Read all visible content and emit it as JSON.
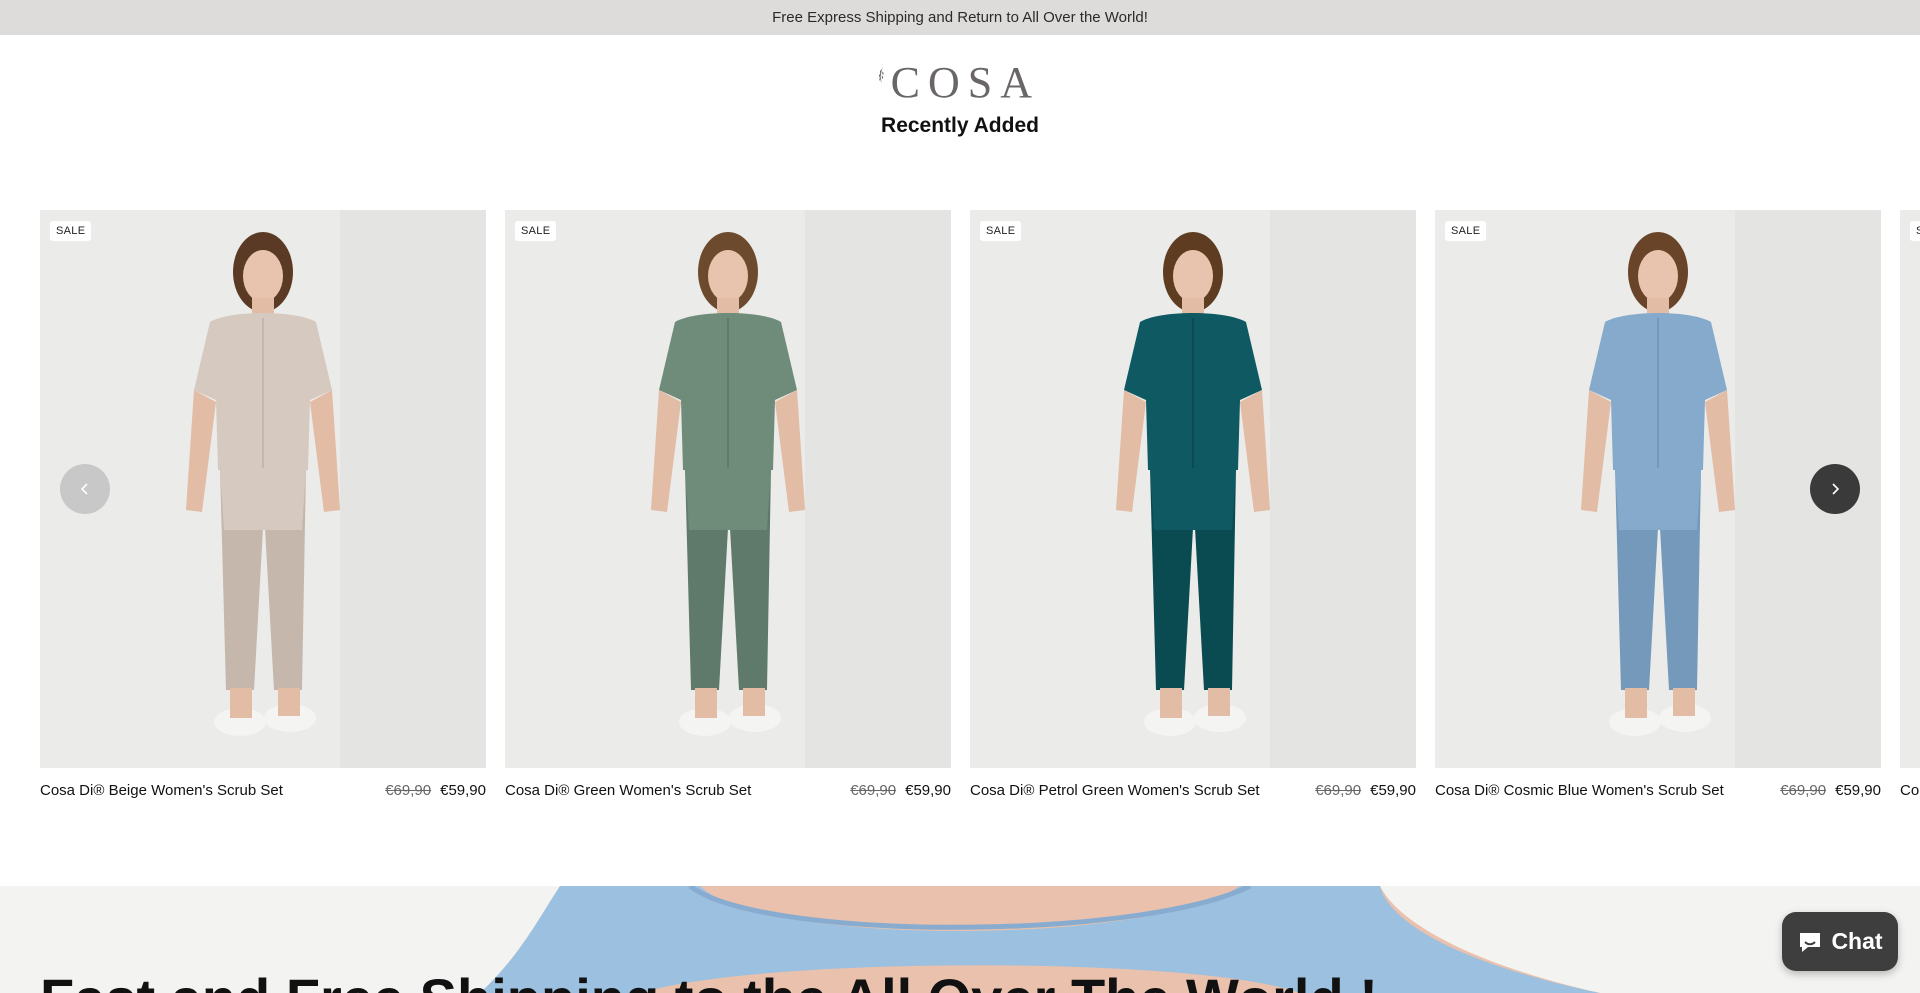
{
  "announcement": "Free Express Shipping and Return to All Over the World!",
  "brand": {
    "logo_text": "COSA"
  },
  "section_title": "Recently Added",
  "products": [
    {
      "badge": "SALE",
      "name": "Cosa Di® Beige Women's Scrub Set",
      "old_price": "€69,90",
      "price": "€59,90",
      "color": "#d6c9bf",
      "color_dark": "#c5b7ac",
      "hair": "#5a3a24"
    },
    {
      "badge": "SALE",
      "name": "Cosa Di® Green Women's Scrub Set",
      "old_price": "€69,90",
      "price": "€59,90",
      "color": "#6f8b7a",
      "color_dark": "#5f7a6a",
      "hair": "#6b4a2e"
    },
    {
      "badge": "SALE",
      "name": "Cosa Di® Petrol Green Women's Scrub Set",
      "old_price": "€69,90",
      "price": "€59,90",
      "color": "#0f5a62",
      "color_dark": "#0a4a51",
      "hair": "#5e3c22"
    },
    {
      "badge": "SALE",
      "name": "Cosa Di® Cosmic Blue Women's Scrub Set",
      "old_price": "€69,90",
      "price": "€59,90",
      "color": "#86aacb",
      "color_dark": "#7499bb",
      "hair": "#6a4428"
    },
    {
      "badge": "SALE",
      "name": "Co",
      "old_price": "",
      "price": "",
      "color": "#d9d6d2",
      "color_dark": "#cfcac4",
      "hair": "#5a3a24"
    }
  ],
  "banner": {
    "heading": "Fast and Free Shipping to the All Over The World !"
  },
  "chat": {
    "label": "Chat"
  },
  "icons": {
    "prev": "chevron-left-icon",
    "next": "chevron-right-icon",
    "chat": "chat-bubble-icon",
    "logo": "leaf-icon"
  },
  "colors": {
    "announce_bg": "#dedbdb",
    "nav_dark": "#3a3a3a",
    "chat_bg": "#3e3e3e"
  }
}
